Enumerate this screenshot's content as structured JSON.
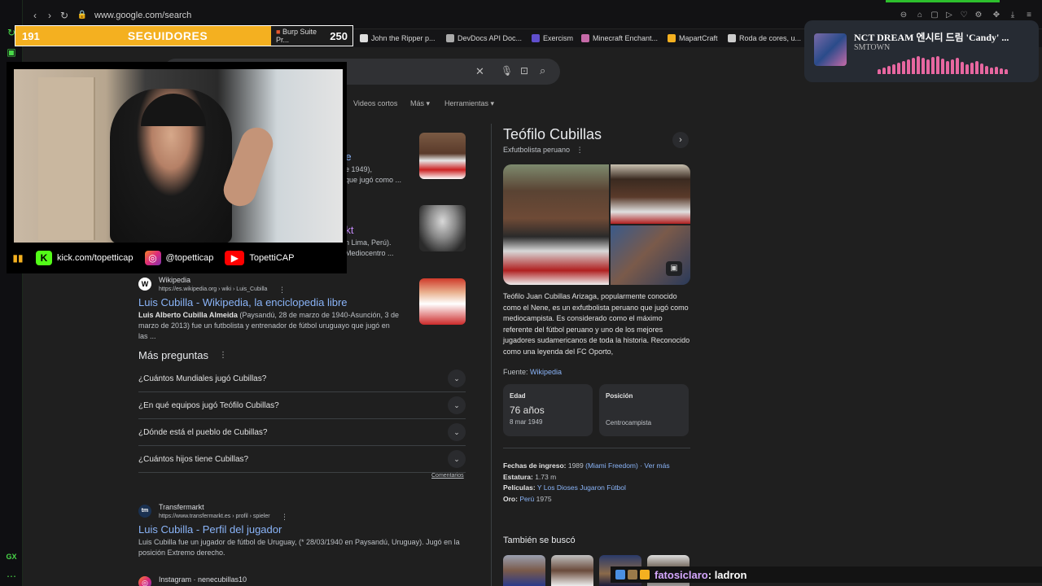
{
  "browser": {
    "url": "www.google.com/search",
    "sidebar_gx_label": "GX"
  },
  "bookmarks": [
    {
      "label": "Burp Suite Pr...",
      "color": "#e4572e"
    },
    {
      "label": "John the Ripper p...",
      "color": "#dddddd"
    },
    {
      "label": "DevDocs API Doc...",
      "color": "#aaaaaa"
    },
    {
      "label": "Exercism",
      "color": "#604fcd"
    },
    {
      "label": "Minecraft Enchant...",
      "color": "#c66aa8"
    },
    {
      "label": "MapartCraft",
      "color": "#f4b020"
    },
    {
      "label": "Roda de cores, u...",
      "color": "#cccccc"
    }
  ],
  "overlay": {
    "followers_count": "191",
    "followers_label": "SEGUIDORES",
    "followers_goal": "250",
    "followers_progress": 0.76,
    "socials": [
      {
        "icon": "kick-icon",
        "label": "kick.com/topetticap"
      },
      {
        "icon": "instagram-icon",
        "label": "@topetticap"
      },
      {
        "icon": "youtube-icon",
        "label": "TopettiCAP"
      }
    ]
  },
  "music": {
    "title": "NCT DREAM 엔시티 드림 'Candy' ...",
    "artist": "SMTOWN"
  },
  "search_tabs": [
    "Videos cortos",
    "Más",
    "Herramientas"
  ],
  "results": [
    {
      "title_fragment": "re",
      "snippet": "e 1949),\nque jugó como ..."
    },
    {
      "title_fragment": "rkt",
      "snippet": "n Lima, Perú).\nMediocentro ..."
    },
    {
      "site": "Wikipedia",
      "url": "https://es.wikipedia.org › wiki › Luis_Cubilla",
      "title": "Luis Cubilla - Wikipedia, la enciclopedia libre",
      "snippet_bold": "Luis Alberto Cubilla Almeida",
      "snippet": " (Paysandú, 28 de marzo de 1940-Asunción, 3 de marzo de 2013) fue un futbolista y entrenador de fútbol uruguayo que jugó en las ..."
    }
  ],
  "more_questions": {
    "heading": "Más preguntas",
    "items": [
      "¿Cuántos Mundiales jugó Cubillas?",
      "¿En qué equipos jugó Teófilo Cubillas?",
      "¿Dónde está el pueblo de Cubillas?",
      "¿Cuántos hijos tiene Cubillas?"
    ],
    "feedback": "Comentarios"
  },
  "transfermarkt": {
    "site": "Transfermarkt",
    "url": "https://www.transfermarkt.es › profil › spieler",
    "title": "Luis Cubilla - Perfil del jugador",
    "snippet": "Luis Cubilla fue un jugador de fútbol de Uruguay, (* 28/03/1940 en Paysandú, Uruguay). Jugó en la posición Extremo derecho."
  },
  "instagram_result": {
    "site": "Instagram · nenecubillas10"
  },
  "knowledge_panel": {
    "title": "Teófilo Cubillas",
    "subtitle": "Exfutbolista peruano",
    "description": "Teófilo Juan Cubillas Arizaga, popularmente conocido como el Nene, es un exfutbolista peruano que jugó como mediocampista. Es considerado como el máximo referente del fútbol peruano y uno de los mejores jugadores sudamericanos de toda la historia. Reconocido como una leyenda del FC Oporto,",
    "source_label": "Fuente:",
    "source_link": "Wikipedia",
    "age_label": "Edad",
    "age_value": "76 años",
    "birth_date": "8 mar 1949",
    "position_label": "Posición",
    "position_value": "Centrocampista",
    "facts": {
      "entry_label": "Fechas de ingreso:",
      "entry_year": "1989",
      "entry_club": "(Miami Freedom)",
      "see_more": "· Ver más",
      "height_label": "Estatura:",
      "height_value": "1.73 m",
      "films_label": "Películas:",
      "films_value": "Y Los Dioses Jugaron Fútbol",
      "gold_label": "Oro:",
      "gold_country": "Perú",
      "gold_year": "1975"
    },
    "also_searched": "También se buscó"
  },
  "chat": {
    "user": "fatosiclaro",
    "message": ": ladron"
  }
}
